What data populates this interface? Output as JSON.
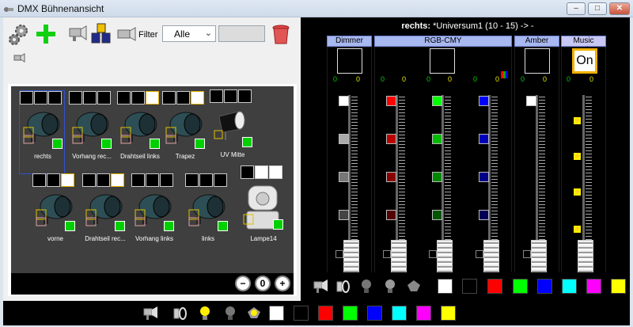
{
  "window": {
    "title": "DMX Bühnenansicht",
    "minimize": "–",
    "maximize": "□",
    "close": "✕"
  },
  "toolbar": {
    "filter_label": "Filter",
    "filter_value": "Alle",
    "tools": [
      "settings-gears-icon",
      "add-plus-icon",
      "fixture-spot-icon",
      "group-icon",
      "fixture-move-icon",
      "trash-icon"
    ]
  },
  "stage": {
    "fixtures": [
      {
        "name": "rechts",
        "selected": true
      },
      {
        "name": "Vorhang rec..."
      },
      {
        "name": "Drahtseil links"
      },
      {
        "name": "Trapez"
      },
      {
        "name": "UV Mitte"
      },
      {
        "name": "vorne"
      },
      {
        "name": "Drahtseil rec..."
      },
      {
        "name": "Vorhang links"
      },
      {
        "name": "links"
      },
      {
        "name": "Lampe14"
      }
    ],
    "zoom_out": "−",
    "zoom_reset": "0",
    "zoom_in": "+"
  },
  "channels": {
    "universe_prefix": "rechts:",
    "universe_text": "*Universum1 (10 - 15) -> -",
    "groups": [
      "Dimmer",
      "RGB-CMY",
      "Amber",
      "Music Strobe"
    ],
    "strobe_button": "On",
    "values": [
      {
        "a": "0",
        "b": "0"
      },
      {
        "a": "0",
        "b": "0"
      },
      {
        "a": "0",
        "b": "0"
      },
      {
        "a": "0",
        "b": "0"
      },
      {
        "a": "0",
        "b": "0"
      },
      {
        "a": "0",
        "b": "0"
      }
    ]
  },
  "palette": {
    "colors": [
      "#ffffff",
      "#000000",
      "#ff0000",
      "#00ff00",
      "#0000ff",
      "#00ffff",
      "#ff00ff",
      "#ffff00"
    ]
  }
}
